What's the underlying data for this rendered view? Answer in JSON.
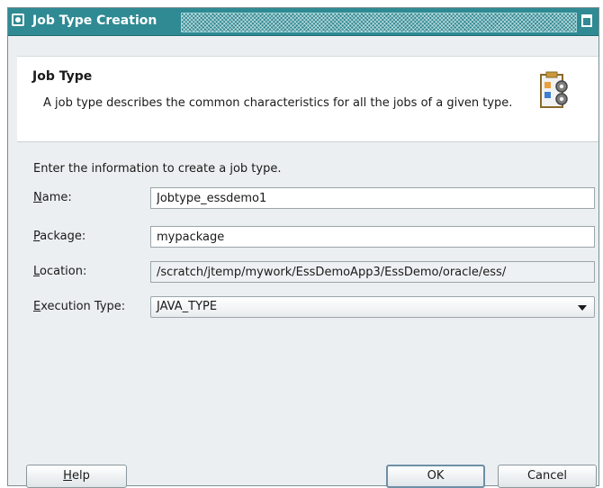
{
  "window": {
    "title": "Job Type Creation"
  },
  "header": {
    "title": "Job Type",
    "description": "A job type describes the common characteristics for all the jobs of a given type."
  },
  "form": {
    "intro": "Enter the information to create a job type.",
    "name": {
      "label_mn": "N",
      "label_rest": "ame:",
      "value": "Jobtype_essdemo1"
    },
    "package": {
      "label_mn": "P",
      "label_rest": "ackage:",
      "value": "mypackage"
    },
    "location": {
      "label_mn": "L",
      "label_rest": "ocation:",
      "value": "/scratch/jtemp/mywork/EssDemoApp3/EssDemo/oracle/ess/"
    },
    "execution_type": {
      "label_mn": "E",
      "label_rest": "xecution Type:",
      "value": "JAVA_TYPE"
    }
  },
  "buttons": {
    "help_mn": "H",
    "help_rest": "elp",
    "ok": "OK",
    "cancel": "Cancel"
  },
  "colors": {
    "titlebar": "#2f8a93",
    "dialog_bg": "#eceff1"
  }
}
